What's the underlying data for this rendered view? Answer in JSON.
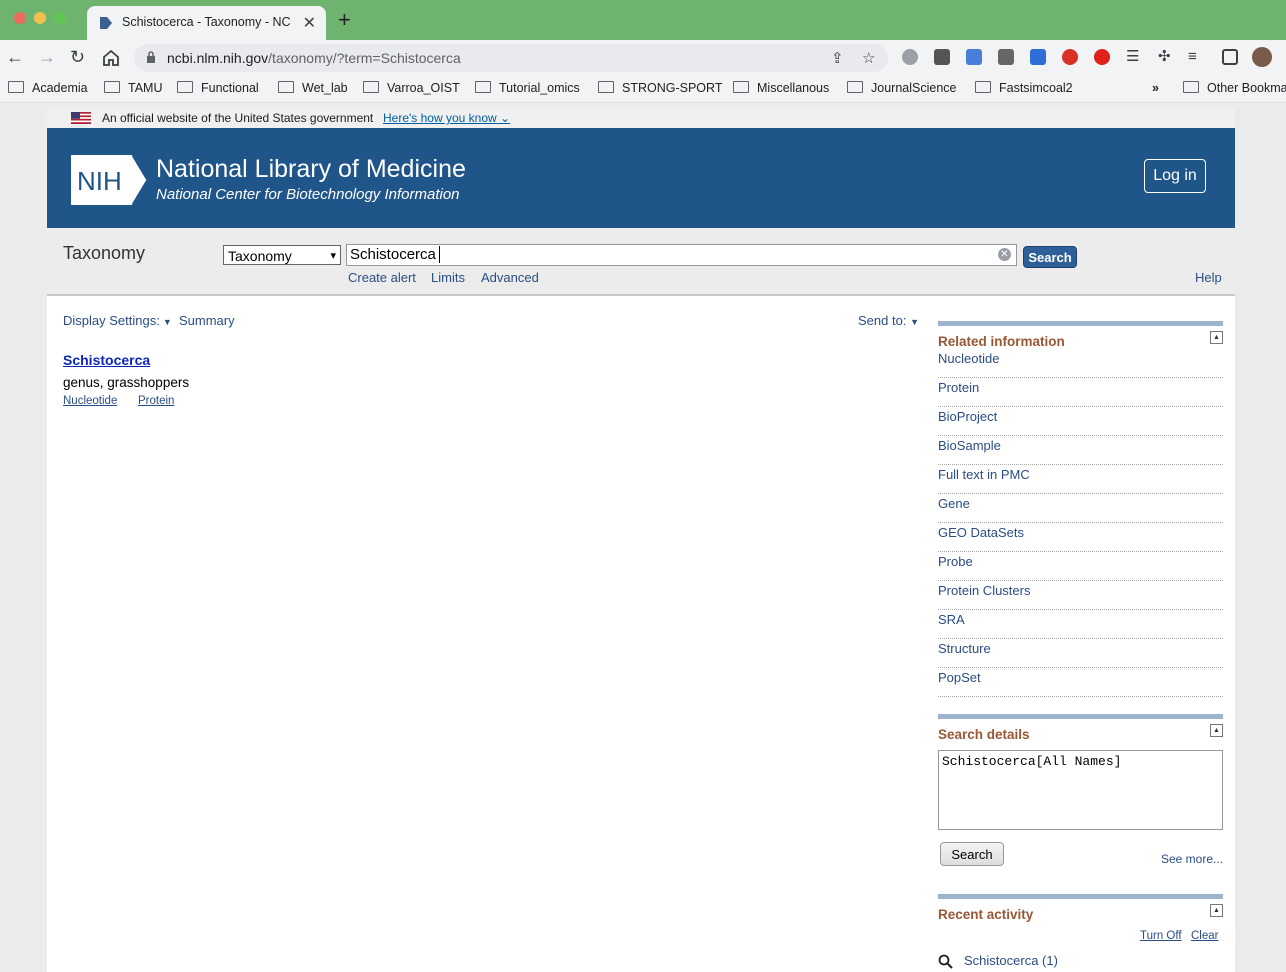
{
  "browser": {
    "tab_title": "Schistocerca - Taxonomy - NC",
    "url_host": "ncbi.nlm.nih.gov",
    "url_path": "/taxonomy/?term=Schistocerca",
    "bookmarks": [
      "Academia",
      "TAMU",
      "Functional",
      "Wet_lab",
      "Varroa_OIST",
      "Tutorial_omics",
      "STRONG-SPORT",
      "Miscellanous",
      "JournalScience",
      "Fastsimcoal2",
      "Other Bookma"
    ],
    "more_bookmarks": "»"
  },
  "gov_banner": {
    "text": "An official website of the United States government",
    "link": "Here's how you know"
  },
  "header": {
    "logo_text": "NIH",
    "title": "National Library of Medicine",
    "subtitle": "National Center for Biotechnology Information",
    "login": "Log in"
  },
  "search": {
    "db_title": "Taxonomy",
    "db_selected": "Taxonomy",
    "term": "Schistocerca",
    "button": "Search",
    "create_alert": "Create alert",
    "limits": "Limits",
    "advanced": "Advanced",
    "help": "Help"
  },
  "results": {
    "display_settings": "Display Settings:",
    "summary": "Summary",
    "send_to": "Send to:",
    "item": {
      "title": "Schistocerca",
      "description": "genus, grasshoppers",
      "links": [
        "Nucleotide",
        "Protein"
      ]
    }
  },
  "related": {
    "heading": "Related information",
    "items": [
      "Nucleotide",
      "Protein",
      "BioProject",
      "BioSample",
      "Full text in PMC",
      "Gene",
      "GEO DataSets",
      "Probe",
      "Protein Clusters",
      "SRA",
      "Structure",
      "PopSet"
    ]
  },
  "search_details": {
    "heading": "Search details",
    "query": "Schistocerca[All Names]",
    "button": "Search",
    "see_more": "See more..."
  },
  "recent_activity": {
    "heading": "Recent activity",
    "turn_off": "Turn Off",
    "clear": "Clear",
    "item": "Schistocerca (1)"
  },
  "colors": {
    "banner": "#20558a",
    "panel_heading": "#985735",
    "link": "#2a4d83",
    "chrome_green": "#6fb46e"
  }
}
